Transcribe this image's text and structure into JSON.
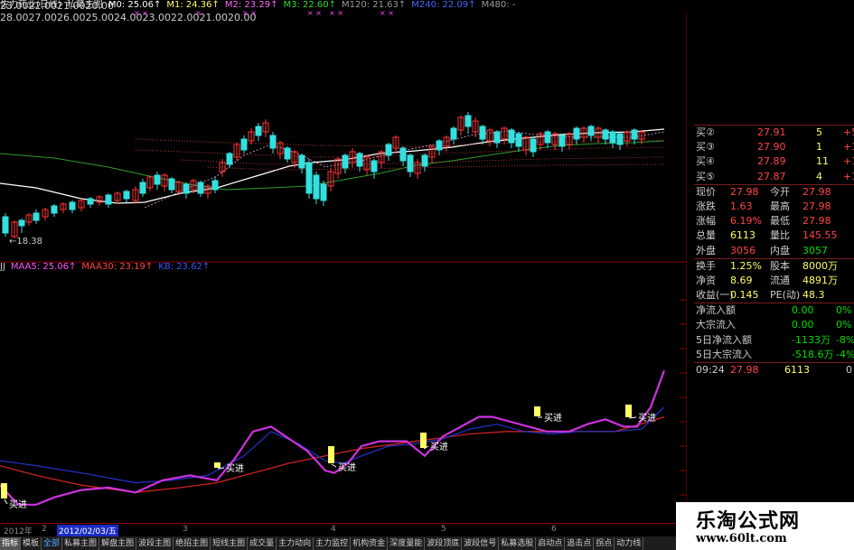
{
  "top_legend": [
    {
      "text": "佐力药业(日线)",
      "color": "#d8d8d8"
    },
    {
      "text": "私募主图",
      "color": "#d8d8d8"
    },
    {
      "text": "M0: 25.06↑",
      "color": "#ffffff"
    },
    {
      "text": "M1: 24.36↑",
      "color": "#ffff66"
    },
    {
      "text": "M2: 23.29↑",
      "color": "#ff66ff"
    },
    {
      "text": "M3: 22.60↑",
      "color": "#33dd33"
    },
    {
      "text": "M120: 21.63↑",
      "color": "#999999"
    },
    {
      "text": "M240: 22.09↑",
      "color": "#4466ff"
    },
    {
      "text": "M480: -",
      "color": "#999999"
    }
  ],
  "top_marks": [
    "× ×",
    "×",
    "× ×",
    "× ×",
    "× ×",
    "× ×"
  ],
  "price_axis": [
    "23.00",
    "22.00",
    "21.00",
    "20.00"
  ],
  "low_label": "←18.38",
  "sub_legend": [
    {
      "text": "JJ",
      "color": "#cccccc"
    },
    {
      "text": "MAA5: 25.06↑",
      "color": "#ff55ff"
    },
    {
      "text": "MAA30: 23.19↑",
      "color": "#ff4444"
    },
    {
      "text": "KB: 23.62↑",
      "color": "#3355ff"
    }
  ],
  "sub_axis": [
    "28.00",
    "27.00",
    "26.00",
    "25.00",
    "24.00",
    "23.00",
    "22.00",
    "21.00",
    "20.00"
  ],
  "buy_label": "买进",
  "quote_panel": {
    "bid_rows": [
      {
        "label": "买②",
        "price": "27.91",
        "vol": "5",
        "chg": "+5"
      },
      {
        "label": "买③",
        "price": "27.90",
        "vol": "1",
        "chg": "+1"
      },
      {
        "label": "买④",
        "price": "27.89",
        "vol": "11",
        "chg": "+11"
      },
      {
        "label": "买⑤",
        "price": "27.87",
        "vol": "4",
        "chg": "+1"
      }
    ],
    "stat_rows": [
      {
        "l1": "现价",
        "v1": "27.98",
        "c1": "#ff4444",
        "l2": "今开",
        "v2": "27.98",
        "c2": "#ff4444"
      },
      {
        "l1": "涨跌",
        "v1": "1.63",
        "c1": "#ff4444",
        "l2": "最高",
        "v2": "27.98",
        "c2": "#ff4444"
      },
      {
        "l1": "涨幅",
        "v1": "6.19%",
        "c1": "#ff4444",
        "l2": "最低",
        "v2": "27.98",
        "c2": "#ff4444"
      },
      {
        "l1": "总量",
        "v1": "6113",
        "c1": "#ffff66",
        "l2": "量比",
        "v2": "145.55",
        "c2": "#ff4444"
      },
      {
        "l1": "外盘",
        "v1": "3056",
        "c1": "#ff4444",
        "l2": "内盘",
        "v2": "3057",
        "c2": "#00dd00"
      },
      {
        "l1": "换手",
        "v1": "1.25%",
        "c1": "#ffff66",
        "l2": "股本",
        "v2": "8000万",
        "c2": "#ffff66"
      },
      {
        "l1": "净资",
        "v1": "8.69",
        "c1": "#ffff66",
        "l2": "流通",
        "v2": "4891万",
        "c2": "#ffff66"
      },
      {
        "l1": "收益(一)",
        "v1": "0.145",
        "c1": "#ffff66",
        "l2": "PE(动)",
        "v2": "48.3",
        "c2": "#ffff66"
      }
    ],
    "flow_rows": [
      {
        "label": "净流入额",
        "v1": "0.00",
        "c1": "#00dd00",
        "v2": "0%",
        "c2": "#00dd00"
      },
      {
        "label": "大宗流入",
        "v1": "0.00",
        "c1": "#00dd00",
        "v2": "0%",
        "c2": "#00dd00"
      },
      {
        "label": "5日净流入额",
        "v1": "-1133万",
        "c1": "#00dd00",
        "v2": "-8%",
        "c2": "#00dd00"
      },
      {
        "label": "5日大宗流入",
        "v1": "-518.6万",
        "c1": "#00dd00",
        "v2": "-4%",
        "c2": "#00dd00"
      }
    ],
    "tick": {
      "time": "09:24",
      "price": "27.98",
      "vol": "6113",
      "dir": "0"
    }
  },
  "date_bar": [
    {
      "text": "2012年",
      "sel": false
    },
    {
      "text": "2",
      "sel": false
    },
    {
      "text": "2012/02/03/五",
      "sel": true
    },
    {
      "text": "3",
      "sel": false
    },
    {
      "text": "4",
      "sel": false
    },
    {
      "text": "5",
      "sel": false
    },
    {
      "text": "6",
      "sel": false
    }
  ],
  "tabs": [
    {
      "text": "指标",
      "sel": true,
      "blue": false
    },
    {
      "text": "模板",
      "sel": false,
      "blue": false
    },
    {
      "text": "全部",
      "sel": false,
      "blue": true
    },
    {
      "text": "私募主图",
      "sel": false,
      "blue": false
    },
    {
      "text": "解盘主图",
      "sel": false,
      "blue": false
    },
    {
      "text": "波段主图",
      "sel": false,
      "blue": false
    },
    {
      "text": "绝招主图",
      "sel": false,
      "blue": false
    },
    {
      "text": "短线主图",
      "sel": false,
      "blue": false
    },
    {
      "text": "成交量",
      "sel": false,
      "blue": false
    },
    {
      "text": "主力动向",
      "sel": false,
      "blue": false
    },
    {
      "text": "主力监控",
      "sel": false,
      "blue": false
    },
    {
      "text": "机构资金",
      "sel": false,
      "blue": false
    },
    {
      "text": "深度量能",
      "sel": false,
      "blue": false
    },
    {
      "text": "波段顶底",
      "sel": false,
      "blue": false
    },
    {
      "text": "波段信号",
      "sel": false,
      "blue": false
    },
    {
      "text": "私募选股",
      "sel": false,
      "blue": false
    },
    {
      "text": "启动点",
      "sel": false,
      "blue": false
    },
    {
      "text": "追击点",
      "sel": false,
      "blue": false
    },
    {
      "text": "拐点",
      "sel": false,
      "blue": false
    },
    {
      "text": "动力线",
      "sel": false,
      "blue": false
    }
  ],
  "watermark": {
    "title": "乐淘公式网",
    "url": "www.60lt.com"
  }
}
